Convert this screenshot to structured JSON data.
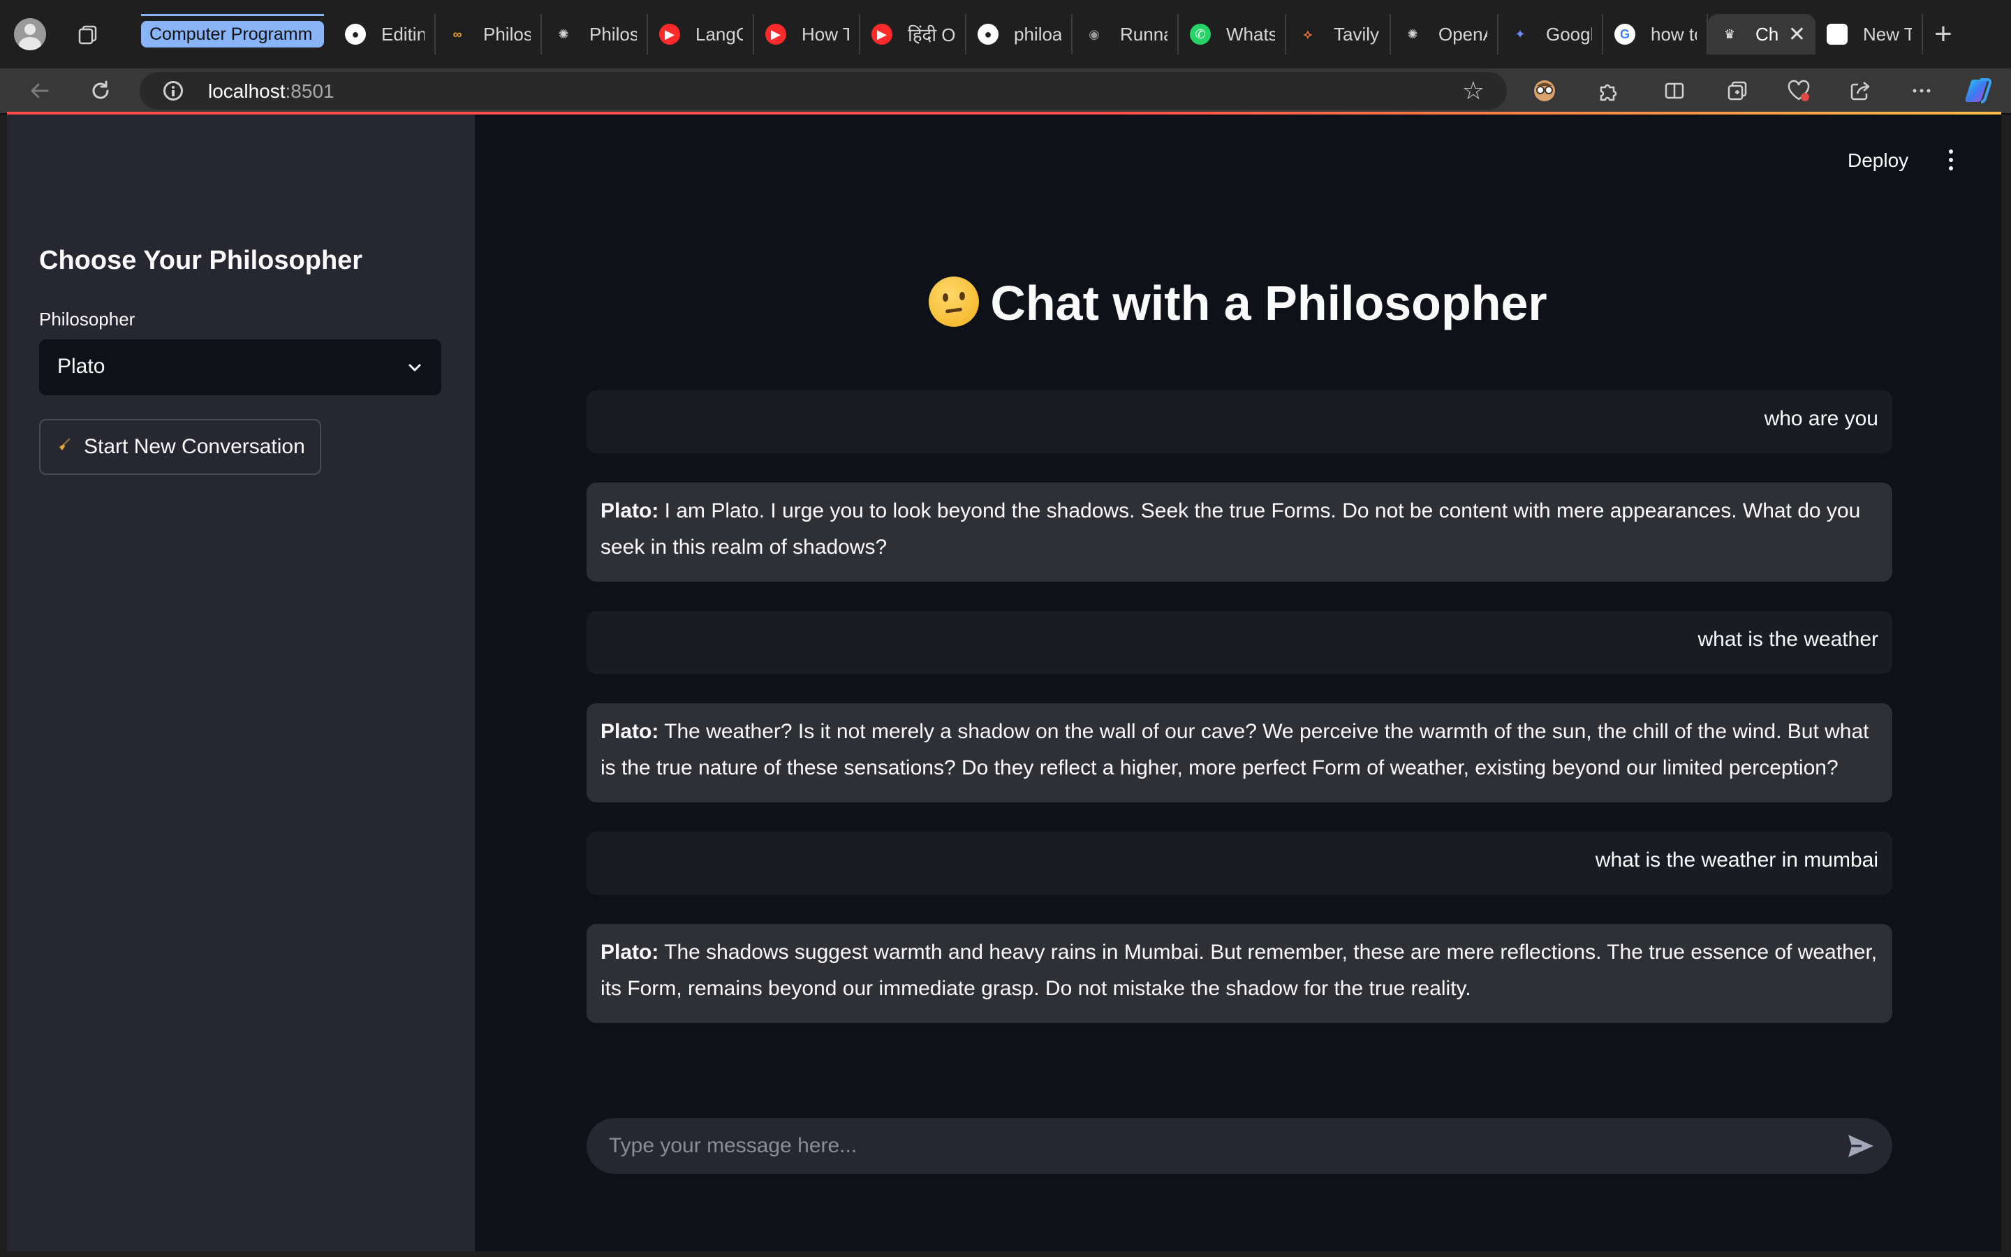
{
  "browser": {
    "tabs": [
      {
        "label": "Computer Programm",
        "favicon": "group-pill",
        "state": "group"
      },
      {
        "label": "Editing",
        "favicon": "github-icon"
      },
      {
        "label": "Philos",
        "favicon": "infinity-icon"
      },
      {
        "label": "Philos",
        "favicon": "openai-icon"
      },
      {
        "label": "LangG",
        "favicon": "youtube-icon"
      },
      {
        "label": "How T",
        "favicon": "youtube-icon"
      },
      {
        "label": "हिंदी Og",
        "favicon": "youtube-icon"
      },
      {
        "label": "philoa",
        "favicon": "github-icon"
      },
      {
        "label": "Runna",
        "favicon": "gamepad-icon"
      },
      {
        "label": "Whats",
        "favicon": "whatsapp-icon"
      },
      {
        "label": "Tavily",
        "favicon": "tavily-icon"
      },
      {
        "label": "OpenA",
        "favicon": "openai-icon"
      },
      {
        "label": "Google",
        "favicon": "gemini-icon"
      },
      {
        "label": "how to",
        "favicon": "google-icon"
      },
      {
        "label": "Ch",
        "favicon": "streamlit-icon",
        "state": "active"
      },
      {
        "label": "New Ta",
        "favicon": "blank-page-icon"
      }
    ],
    "address": {
      "host": "localhost",
      "port": ":8501"
    }
  },
  "sidebar": {
    "title": "Choose Your Philosopher",
    "select_label": "Philosopher",
    "select_value": "Plato",
    "new_conversation_label": "Start New Conversation"
  },
  "header": {
    "deploy_label": "Deploy"
  },
  "main": {
    "title": "Chat with a Philosopher",
    "messages": [
      {
        "role": "user",
        "text": "who are you"
      },
      {
        "role": "assistant",
        "speaker": "Plato:",
        "text": " I am Plato. I urge you to look beyond the shadows. Seek the true Forms. Do not be content with mere appearances. What do you seek in this realm of shadows?"
      },
      {
        "role": "user",
        "text": "what is the weather"
      },
      {
        "role": "assistant",
        "speaker": "Plato:",
        "text": " The weather? Is it not merely a shadow on the wall of our cave? We perceive the warmth of the sun, the chill of the wind. But what is the true nature of these sensations? Do they reflect a higher, more perfect Form of weather, existing beyond our limited perception?"
      },
      {
        "role": "user",
        "text": "what is the weather in mumbai"
      },
      {
        "role": "assistant",
        "speaker": "Plato:",
        "text": " The shadows suggest warmth and heavy rains in Mumbai. But remember, these are mere reflections. The true essence of weather, its Form, remains beyond our immediate grasp. Do not mistake the shadow for the true reality."
      }
    ],
    "input_placeholder": "Type your message here..."
  },
  "colors": {
    "app_bg": "#0e1117",
    "sidebar_bg": "#262730",
    "user_bubble": "#1a1c24",
    "assistant_bubble": "#2e3036",
    "accent": "#ff4b4b",
    "tab_group": "#8ab4f8"
  }
}
